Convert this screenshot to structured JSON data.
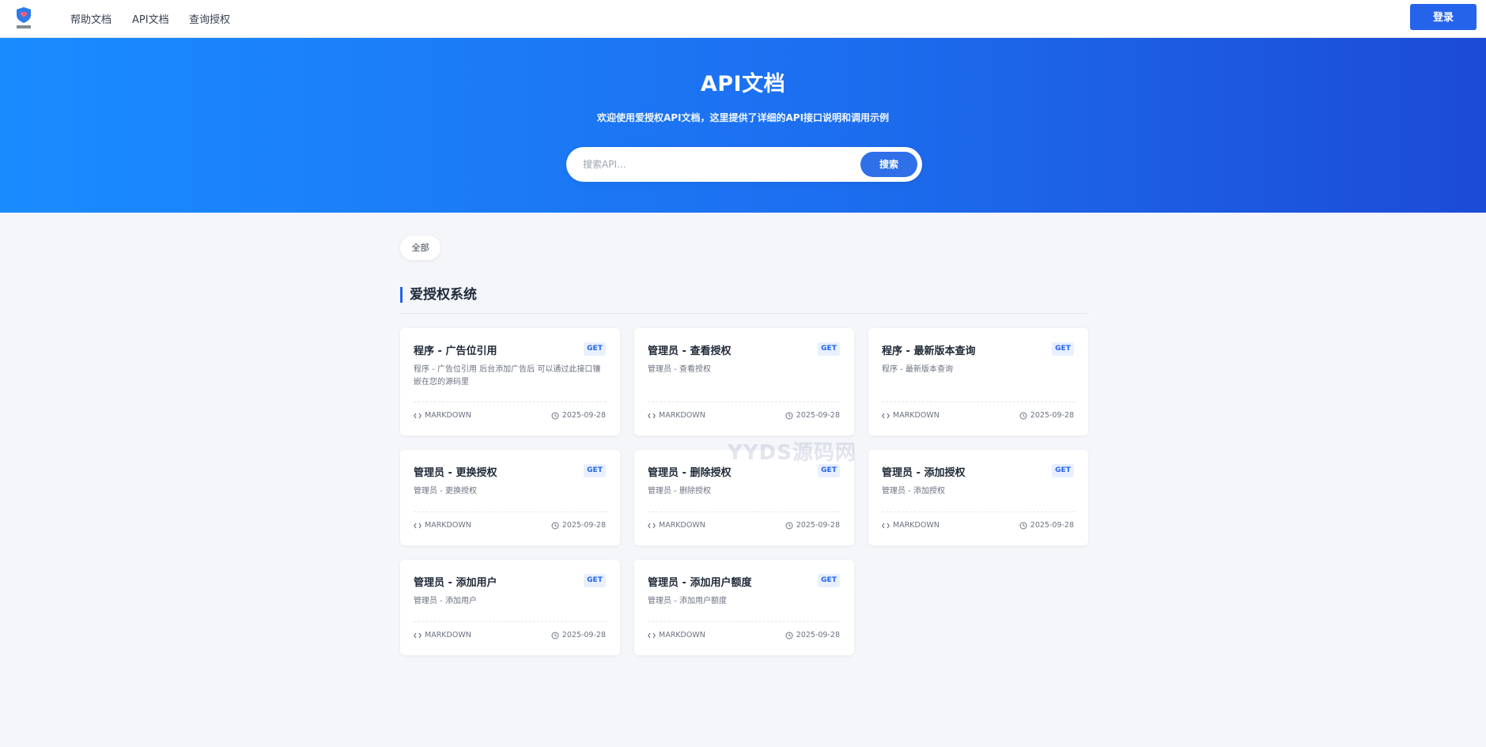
{
  "nav": {
    "logo_label": "爱授权",
    "items": [
      {
        "label": "帮助文档"
      },
      {
        "label": "API文档"
      },
      {
        "label": "查询授权"
      }
    ],
    "login_label": "登录"
  },
  "hero": {
    "title": "API文档",
    "subtitle": "欢迎使用爱授权API文档，这里提供了详细的API接口说明和调用示例",
    "search_placeholder": "搜索API...",
    "search_button": "搜索"
  },
  "filter": {
    "label": "全部"
  },
  "section": {
    "title": "爱授权系统"
  },
  "cards": [
    {
      "title": "程序 - 广告位引用",
      "method": "GET",
      "desc": "程序 - 广告位引用 后台添加广告后 可以通过此接口镶嵌在您的源码里",
      "type": "MARKDOWN",
      "date": "2025-09-28"
    },
    {
      "title": "管理员 - 查看授权",
      "method": "GET",
      "desc": "管理员 - 查看授权",
      "type": "MARKDOWN",
      "date": "2025-09-28"
    },
    {
      "title": "程序 - 最新版本查询",
      "method": "GET",
      "desc": "程序 - 最新版本查询",
      "type": "MARKDOWN",
      "date": "2025-09-28"
    },
    {
      "title": "管理员 - 更换授权",
      "method": "GET",
      "desc": "管理员 - 更换授权",
      "type": "MARKDOWN",
      "date": "2025-09-28"
    },
    {
      "title": "管理员 - 删除授权",
      "method": "GET",
      "desc": "管理员 - 删除授权",
      "type": "MARKDOWN",
      "date": "2025-09-28"
    },
    {
      "title": "管理员 - 添加授权",
      "method": "GET",
      "desc": "管理员 - 添加授权",
      "type": "MARKDOWN",
      "date": "2025-09-28"
    },
    {
      "title": "管理员 - 添加用户",
      "method": "GET",
      "desc": "管理员 - 添加用户",
      "type": "MARKDOWN",
      "date": "2025-09-28"
    },
    {
      "title": "管理员 - 添加用户额度",
      "method": "GET",
      "desc": "管理员 - 添加用户额度",
      "type": "MARKDOWN",
      "date": "2025-09-28"
    }
  ],
  "watermark": "YYDS源码网",
  "colors": {
    "accent": "#2563eb",
    "hero_start": "#1a8cff",
    "hero_end": "#1c4bd6"
  }
}
